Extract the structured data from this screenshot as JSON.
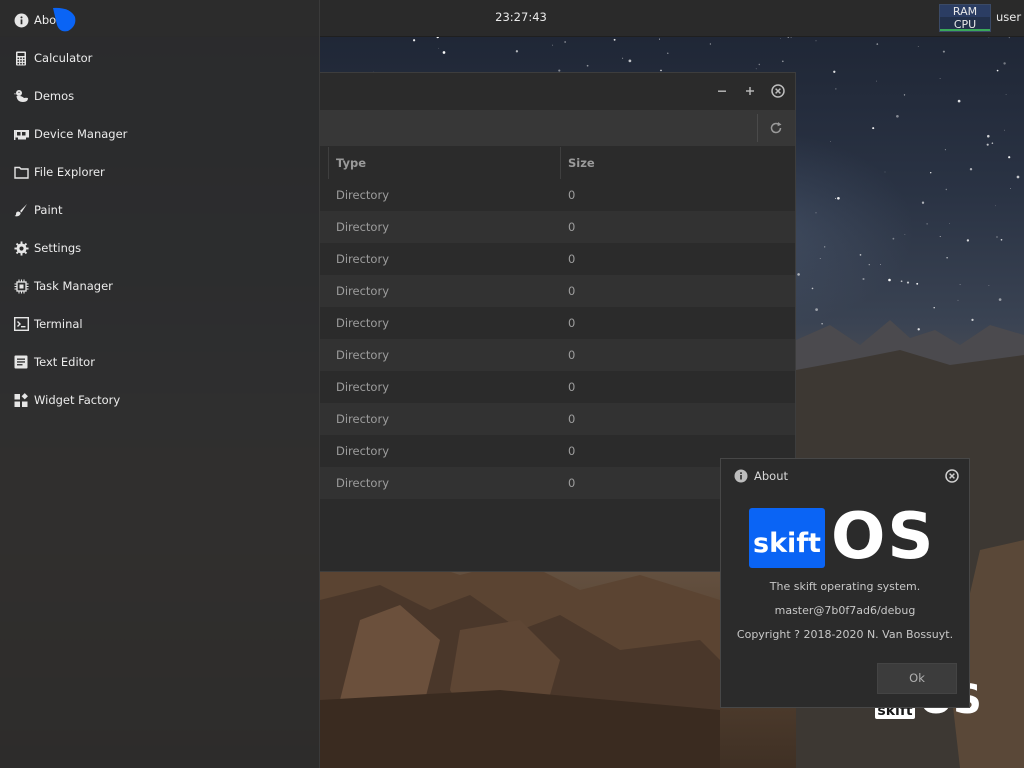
{
  "taskbar": {
    "clock": "23:27:43",
    "ram_label": "RAM",
    "cpu_label": "CPU",
    "user": "user"
  },
  "menu": {
    "items": [
      {
        "label": "About",
        "icon": "info-icon"
      },
      {
        "label": "Calculator",
        "icon": "calculator-icon"
      },
      {
        "label": "Demos",
        "icon": "duck-icon"
      },
      {
        "label": "Device Manager",
        "icon": "expansion-card-icon"
      },
      {
        "label": "File Explorer",
        "icon": "folder-icon"
      },
      {
        "label": "Paint",
        "icon": "brush-icon"
      },
      {
        "label": "Settings",
        "icon": "gear-icon"
      },
      {
        "label": "Task Manager",
        "icon": "chip-icon"
      },
      {
        "label": "Terminal",
        "icon": "console-icon"
      },
      {
        "label": "Text Editor",
        "icon": "text-document-icon"
      },
      {
        "label": "Widget Factory",
        "icon": "widgets-icon"
      }
    ]
  },
  "explorer": {
    "window_controls": {
      "minimize": "−",
      "maximize": "+"
    },
    "columns": {
      "type": "Type",
      "size": "Size"
    },
    "rows": [
      {
        "type": "Directory",
        "size": "0"
      },
      {
        "type": "Directory",
        "size": "0"
      },
      {
        "type": "Directory",
        "size": "0"
      },
      {
        "type": "Directory",
        "size": "0"
      },
      {
        "type": "Directory",
        "size": "0"
      },
      {
        "type": "Directory",
        "size": "0"
      },
      {
        "type": "Directory",
        "size": "0"
      },
      {
        "type": "Directory",
        "size": "0"
      },
      {
        "type": "Directory",
        "size": "0"
      },
      {
        "type": "Directory",
        "size": "0"
      }
    ]
  },
  "about": {
    "title": "About",
    "logo_box_text": "skift",
    "logo_os_text": "OS",
    "description": "The skift operating system.",
    "version": "master@7b0f7ad6/debug",
    "copyright": "Copyright ? 2018-2020 N. Van Bossuyt.",
    "ok_label": "Ok"
  },
  "desktop": {
    "watermark_box_text": "skift",
    "watermark_os_text": "OS"
  },
  "colors": {
    "accent": "#0a64f5",
    "panel": "#2b2b2b",
    "menu_bg": "#2c2c2c"
  }
}
